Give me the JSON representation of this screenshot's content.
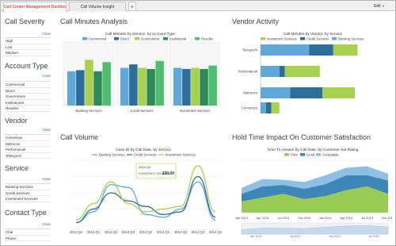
{
  "tabs": [
    {
      "label": "Call Center Management Dashboard",
      "active": true
    },
    {
      "label": "Call Volume Insight",
      "active": false
    }
  ],
  "add_tab": "+",
  "edit_label": "Edit",
  "sidebar": {
    "clear_label": "Clear",
    "groups": [
      {
        "title": "Call Severity",
        "items": [
          "High",
          "Low",
          "Medium"
        ]
      },
      {
        "title": "Account Type",
        "items": [
          "Commercial",
          "Direct",
          "Government",
          "Institutional",
          "Reseller"
        ]
      },
      {
        "title": "Vendor",
        "items": [
          "Conversys",
          "Metricom",
          "PerformacalI",
          "Telesynch"
        ]
      },
      {
        "title": "Service",
        "items": [
          "Banking Services",
          "Credit Services",
          "Investment Services"
        ]
      },
      {
        "title": "Contact Type",
        "items": [
          "Chat",
          "Phone"
        ]
      }
    ]
  },
  "panels": {
    "call_minutes": "Call Minutes Analysis",
    "vendor_activity": "Vendor Activity",
    "call_volume": "Call Volume",
    "hold_time": "Hold Time Impact On Customer Satisfaction"
  },
  "colors": {
    "commercial": "#5fa8d8",
    "direct": "#2c6e9b",
    "government": "#a8d14f",
    "institutional": "#2e8b57",
    "reseller": "#4fbf6f",
    "investment": "#a8d14f",
    "credit": "#2c6e9b",
    "banking": "#5fa8d8",
    "poor": "#9acb57",
    "good": "#3f86b8",
    "acceptable": "#8fc0e3"
  },
  "chart_data": [
    {
      "type": "bar",
      "title": "Call Minutes by Service, by Account Type",
      "categories": [
        "Banking Services",
        "Credit Services",
        "Investment Services"
      ],
      "series": [
        {
          "name": "Commercial",
          "values": [
            30,
            33,
            33
          ]
        },
        {
          "name": "Direct",
          "values": [
            31,
            36,
            32
          ]
        },
        {
          "name": "Government",
          "values": [
            40,
            33,
            33
          ]
        },
        {
          "name": "Institutional",
          "values": [
            30,
            32,
            32
          ]
        },
        {
          "name": "Reseller",
          "values": [
            38,
            39,
            35
          ]
        }
      ],
      "ylim": [
        0,
        50
      ]
    },
    {
      "type": "bar",
      "orientation": "horizontal",
      "stacked": true,
      "title": "Call Minutes by Vendor, by Service",
      "categories": [
        "Telesynch",
        "PerformacalI",
        "Metricom",
        "Conversys"
      ],
      "series": [
        {
          "name": "Investment Services",
          "values": [
            9,
            13,
            12,
            3
          ]
        },
        {
          "name": "Credit Services",
          "values": [
            9,
            2,
            12,
            2
          ]
        },
        {
          "name": "Banking Services",
          "values": [
            18,
            7,
            11,
            2
          ]
        }
      ]
    },
    {
      "type": "line",
      "title": "Case ID by Call Date, by Service",
      "x": [
        "2012 Q4",
        "2013 Q1",
        "2013 Q2",
        "2013 Q3",
        "2013 Q4",
        "2014 Q1",
        "2014 Q2",
        "2014 Q3",
        "2014 Q4"
      ],
      "series": [
        {
          "name": "Banking Services",
          "values": [
            10,
            50,
            150,
            140,
            40,
            30,
            60,
            160,
            20
          ]
        },
        {
          "name": "Credit Services",
          "values": [
            10,
            60,
            120,
            90,
            70,
            40,
            50,
            180,
            30
          ]
        },
        {
          "name": "Investment Services",
          "values": [
            20,
            80,
            160,
            80,
            50,
            60,
            70,
            220,
            50
          ]
        }
      ],
      "tooltip": {
        "title": "2014 Q3",
        "label": "Investment Services:",
        "value": "220.00"
      }
    },
    {
      "type": "area",
      "stacked": true,
      "title": "Time To Answer by Call Date, by Customer Sat Rating",
      "x": [
        "Jan 2013",
        "Apr 2013",
        "Jul 2013",
        "Oct 2013",
        "Jan 2014",
        "Apr 2014",
        "Jul 2014",
        "Oct 2014"
      ],
      "series": [
        {
          "name": "Poor",
          "values": [
            15,
            20,
            25,
            18,
            22,
            30,
            35,
            25
          ]
        },
        {
          "name": "Good",
          "values": [
            10,
            15,
            12,
            14,
            16,
            20,
            15,
            18
          ]
        },
        {
          "name": "Acceptable",
          "values": [
            8,
            10,
            7,
            9,
            12,
            10,
            12,
            9
          ]
        }
      ],
      "navigator_labels": [
        "Jan 2013",
        "Jul 2013",
        "Jan 2014",
        "Jul 2014"
      ]
    }
  ]
}
